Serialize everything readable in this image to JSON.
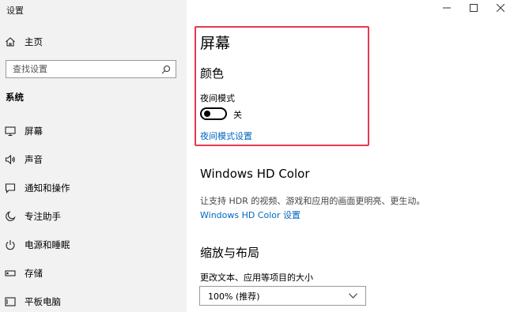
{
  "window": {
    "title": "设置",
    "controls": [
      "minimize",
      "maximize",
      "close"
    ]
  },
  "sidebar": {
    "home_label": "主页",
    "search_placeholder": "查找设置",
    "section_label": "系统",
    "items": [
      {
        "label": "屏幕",
        "icon": "monitor-icon"
      },
      {
        "label": "声音",
        "icon": "speaker-icon"
      },
      {
        "label": "通知和操作",
        "icon": "notification-icon"
      },
      {
        "label": "专注助手",
        "icon": "moon-icon"
      },
      {
        "label": "电源和睡眠",
        "icon": "power-icon"
      },
      {
        "label": "存储",
        "icon": "storage-icon"
      },
      {
        "label": "平板电脑",
        "icon": "tablet-icon"
      }
    ]
  },
  "main": {
    "page_title": "屏幕",
    "color_heading": "颜色",
    "night_mode_label": "夜间模式",
    "night_mode_state": "关",
    "night_mode_on": false,
    "night_mode_settings_link": "夜间模式设置",
    "hd_color_heading": "Windows HD Color",
    "hd_color_description": "让支持 HDR 的视频、游戏和应用的画面更明亮、更生动。",
    "hd_color_link": "Windows HD Color 设置",
    "scale_heading": "缩放与布局",
    "scale_label": "更改文本、应用等项目的大小",
    "scale_value": "100% (推荐)"
  },
  "colors": {
    "accent": "#0067c0",
    "highlight_border": "#e8384f",
    "sidebar_bg": "#f2f2f2"
  }
}
